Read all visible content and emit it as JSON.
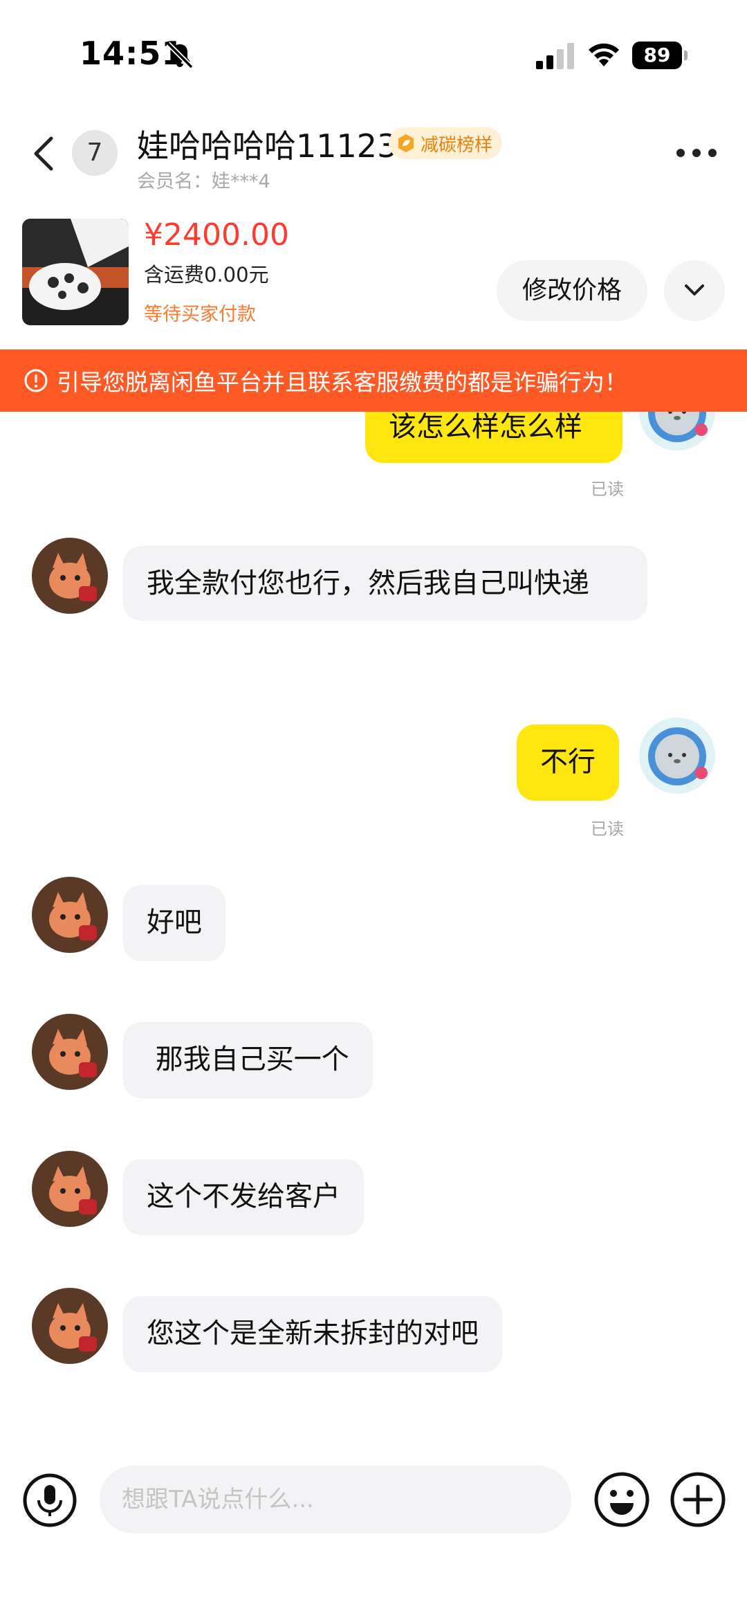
{
  "status_bar": {
    "time": "14:51",
    "battery": "89"
  },
  "header": {
    "unread_count": "7",
    "contact_name": "娃哈哈哈哈11123",
    "badge": "减碳榜样",
    "member_name": "会员名：娃***4"
  },
  "order": {
    "price": "¥2400.00",
    "shipping": "含运费0.00元",
    "status": "等待买家付款",
    "modify_price_label": "修改价格"
  },
  "warning": "引导您脱离闲鱼平台并且联系客服缴费的都是诈骗行为！",
  "messages": [
    {
      "from": "me",
      "text": "该怎么样怎么样",
      "status": "已读"
    },
    {
      "from": "them",
      "text": "我全款付您也行，然后我自己叫快递"
    },
    {
      "from": "me",
      "text": "不行",
      "status": "已读"
    },
    {
      "from": "them",
      "text": "好吧"
    },
    {
      "from": "them",
      "text": " 那我自己买一个"
    },
    {
      "from": "them",
      "text": "这个不发给客户"
    },
    {
      "from": "them",
      "text": "您这个是全新未拆封的对吧"
    }
  ],
  "input": {
    "placeholder": "想跟TA说点什么..."
  },
  "colors": {
    "price": "#ff3b30",
    "warning_bg": "#ff5a25",
    "my_bubble": "#ffe60f",
    "their_bubble": "#f3f3f5",
    "badge_text": "#e8820c"
  },
  "icons": [
    "bell-slash-icon",
    "cellular-icon",
    "wifi-icon",
    "battery-icon",
    "back-icon",
    "leaf-badge-icon",
    "more-icon",
    "chevron-down-icon",
    "warning-icon",
    "voice-icon",
    "emoji-icon",
    "plus-icon"
  ]
}
